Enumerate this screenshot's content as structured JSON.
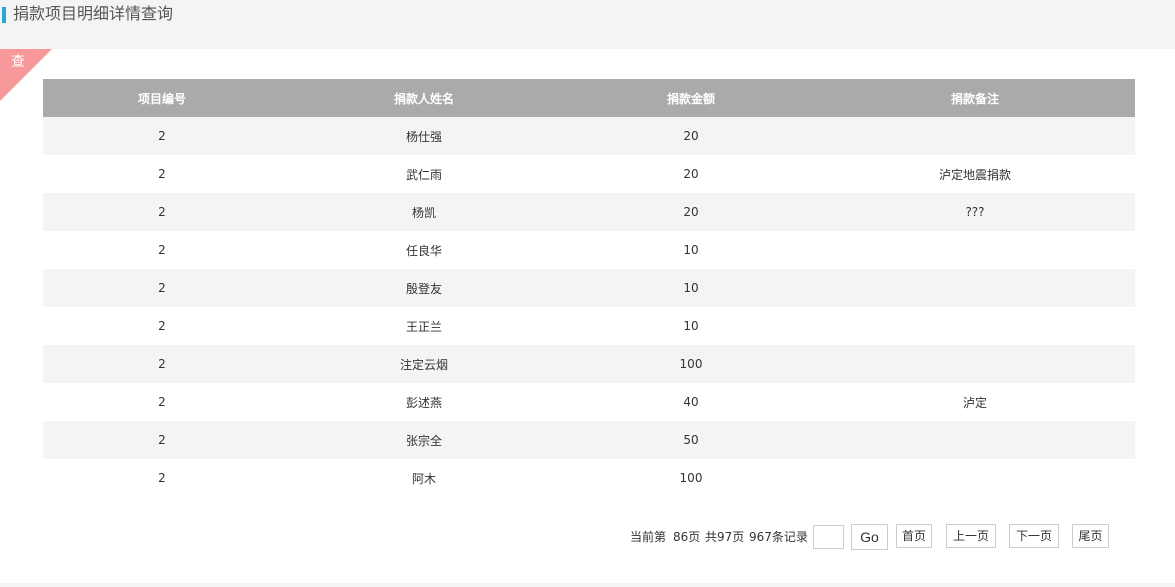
{
  "page": {
    "title": "捐款项目明细详情查询",
    "accent_color": "#2aa8d8"
  },
  "corner_tag": {
    "label": "查",
    "color": "#f7989a"
  },
  "table": {
    "header_color": "#aaaaaa",
    "columns": [
      "项目编号",
      "捐款人姓名",
      "捐款金额",
      "捐款备注"
    ],
    "rows": [
      [
        "2",
        "杨仕强",
        "20",
        ""
      ],
      [
        "2",
        "武仁雨",
        "20",
        "泸定地震捐款"
      ],
      [
        "2",
        "杨凯",
        "20",
        "???"
      ],
      [
        "2",
        "任良华",
        "10",
        ""
      ],
      [
        "2",
        "殷登友",
        "10",
        ""
      ],
      [
        "2",
        "王正兰",
        "10",
        ""
      ],
      [
        "2",
        "注定云烟",
        "100",
        ""
      ],
      [
        "2",
        "彭述燕",
        "40",
        "泸定"
      ],
      [
        "2",
        "张宗全",
        "50",
        ""
      ],
      [
        "2",
        "阿木",
        "100",
        ""
      ]
    ]
  },
  "pager": {
    "current_label": "当前第",
    "current_value": "86页",
    "total_label": "共97页",
    "records_label": "967条记录",
    "page_input_value": "",
    "go": "Go",
    "first": "首页",
    "prev": "上一页",
    "next": "下一页",
    "last": "尾页"
  }
}
